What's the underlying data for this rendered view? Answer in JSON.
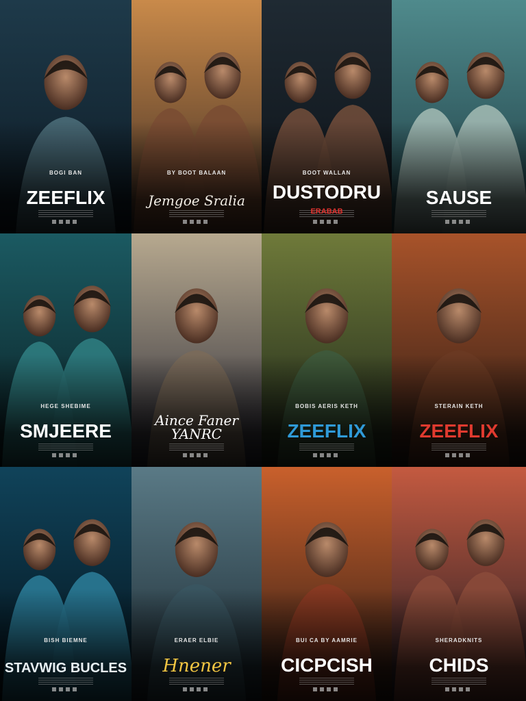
{
  "posters": [
    {
      "tagline": "BOGI BAN",
      "title": "ZEEFLIX",
      "subtitle": "",
      "title_color": "#ffffff",
      "palette": [
        "#1e3a4a",
        "#0d1a24",
        "#4a6b78"
      ],
      "subject": "man-with-sunglasses"
    },
    {
      "tagline": "BY BOOT BALAAN",
      "title": "Jemgoe Sralia",
      "subtitle": "",
      "title_color": "#f2eee6",
      "palette": [
        "#c98a4a",
        "#3b2a22",
        "#7a4d33"
      ],
      "subject": "couple-embracing"
    },
    {
      "tagline": "BOOT WALLAN",
      "title": "DUSTODRU",
      "subtitle": "ERABAB",
      "title_color": "#ffffff",
      "subtitle_color": "#e0332f",
      "palette": [
        "#1f2a33",
        "#0c1116",
        "#6e4b3a"
      ],
      "subject": "father-and-daughter"
    },
    {
      "tagline": "",
      "title": "SAUSE",
      "subtitle": "",
      "title_color": "#ffffff",
      "palette": [
        "#4f8a8c",
        "#1d3b42",
        "#9fb7b0"
      ],
      "subject": "mother-and-child"
    },
    {
      "tagline": "HEGE SHEBIME",
      "title": "SMJEERE",
      "subtitle": "",
      "title_color": "#ffffff",
      "palette": [
        "#1b5a62",
        "#0a1e22",
        "#2f7c80"
      ],
      "subject": "two-men-split"
    },
    {
      "tagline": "",
      "title": "Aince Faner YANRC",
      "subtitle": "",
      "title_color": "#ffffff",
      "subtitle_color": "#e0332f",
      "palette": [
        "#b7a98f",
        "#2a2a36",
        "#7a6a5a"
      ],
      "subject": "curly-haired-woman"
    },
    {
      "tagline": "BOBIS AERIS KETH",
      "title": "ZEEFLIX",
      "subtitle": "",
      "title_color": "#2f9ad8",
      "palette": [
        "#6f7a3a",
        "#1a2418",
        "#3e5a3c"
      ],
      "subject": "man-with-glasses"
    },
    {
      "tagline": "STERAIN KETH",
      "title": "ZEEFLIX",
      "subtitle": "",
      "title_color": "#e03a2f",
      "palette": [
        "#a8532a",
        "#2a1a14",
        "#6a3a22"
      ],
      "subject": "grizzled-man"
    },
    {
      "tagline": "BISH BIEMNE",
      "title": "STAVWIG BUCLES",
      "subtitle": "",
      "title_color": "#e8f0f4",
      "palette": [
        "#10435a",
        "#04121b",
        "#2a7a96"
      ],
      "subject": "sci-fi-faces"
    },
    {
      "tagline": "ERAER ELBIE",
      "title": "Hnener",
      "subtitle": "",
      "title_color": "#f2c542",
      "palette": [
        "#5a7a86",
        "#1a2830",
        "#3a5560"
      ],
      "subject": "young-woman"
    },
    {
      "tagline": "BUI CA BY AAMRIE",
      "title": "CICPCISH",
      "subtitle": "",
      "title_color": "#ffffff",
      "palette": [
        "#c9602c",
        "#2a1a14",
        "#8a3a22"
      ],
      "subject": "man-in-red-hat"
    },
    {
      "tagline": "SHERADKNITS",
      "title": "CHIDS",
      "subtitle": "",
      "title_color": "#ffffff",
      "palette": [
        "#c45a40",
        "#1e1a22",
        "#8a4a3a"
      ],
      "subject": "two-elderly-figures"
    }
  ]
}
